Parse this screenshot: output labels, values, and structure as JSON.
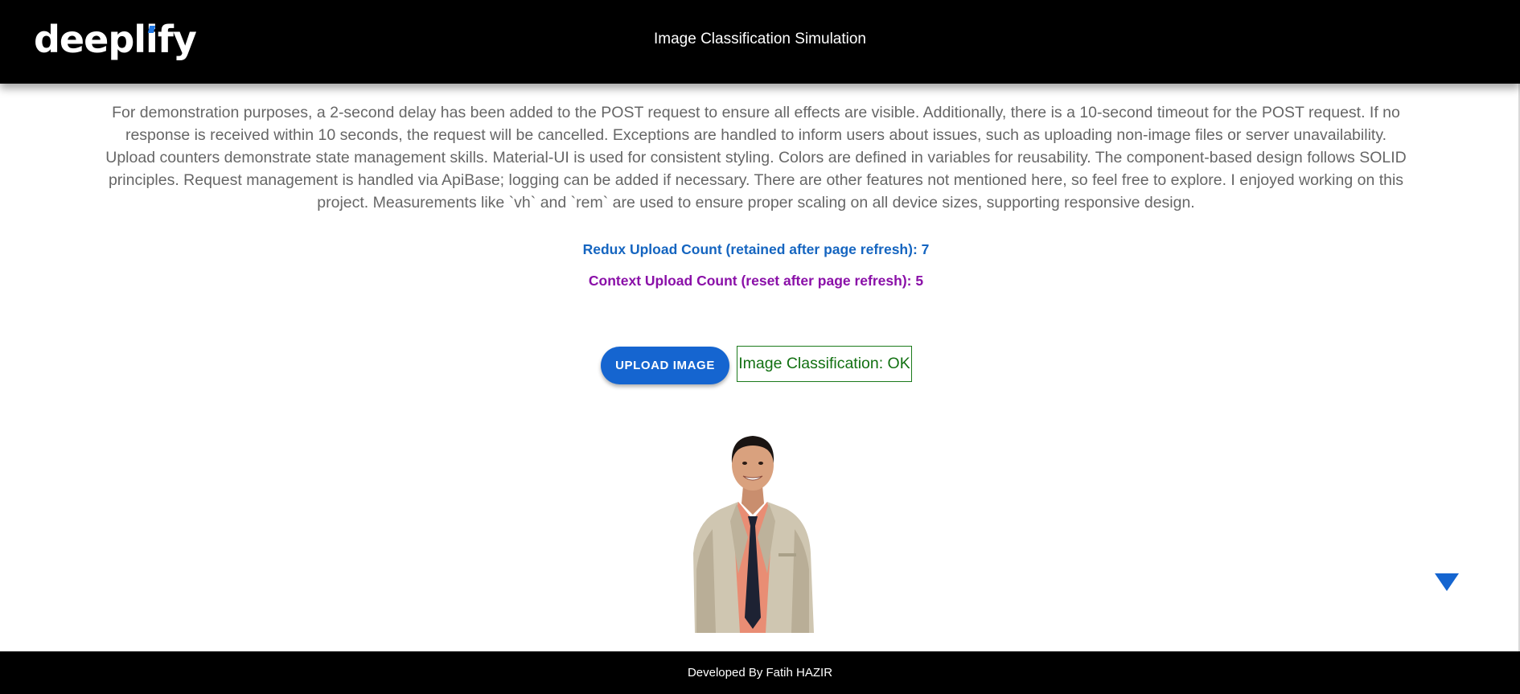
{
  "header": {
    "logo_text_main": "deepl",
    "logo_text_accent": "i",
    "logo_text_end": "fy",
    "title": "Image Classification Simulation"
  },
  "main": {
    "description": "For demonstration purposes, a 2-second delay has been added to the POST request to ensure all effects are visible. Additionally, there is a 10-second timeout for the POST request. If no response is received within 10 seconds, the request will be cancelled. Exceptions are handled to inform users about issues, such as uploading non-image files or server unavailability. Upload counters demonstrate state management skills. Material-UI is used for consistent styling. Colors are defined in variables for reusability. The component-based design follows SOLID principles. Request management is handled via ApiBase; logging can be added if necessary. There are other features not mentioned here, so feel free to explore. I enjoyed working on this project. Measurements like `vh` and `rem` are used to ensure proper scaling on all device sizes, supporting responsive design.",
    "redux_counter": "Redux Upload Count (retained after page refresh): 7",
    "context_counter": "Context Upload Count (reset after page refresh): 5",
    "upload_button_label": "UPLOAD IMAGE",
    "classification_result": "Image Classification: OK",
    "scroll_indicator_icon": "triangle-down-icon"
  },
  "footer": {
    "credit": "Developed By Fatih HAZIR"
  },
  "colors": {
    "header_bg": "#000000",
    "accent_blue": "#1565d0",
    "redux_text": "#1565c0",
    "context_text": "#8a10a8",
    "result_green": "#117011",
    "body_text": "#666666"
  }
}
